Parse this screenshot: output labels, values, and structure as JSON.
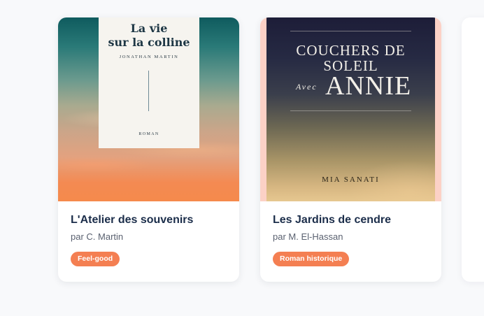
{
  "colors": {
    "background": "#f8f9fb",
    "card": "#ffffff",
    "title": "#1b2d4a",
    "author": "#5a6170",
    "tag": "#f47f52"
  },
  "books": [
    {
      "cover": {
        "title": "La vie\nsur la colline",
        "author": "JONATHAN MARTIN",
        "genre": "ROMAN"
      },
      "title": "L'Atelier des souvenirs",
      "author": "par C. Martin",
      "tag": "Feel-good"
    },
    {
      "cover": {
        "title": "COUCHERS DE\nSOLEIL",
        "avec": "Avec",
        "name": "ANNIE",
        "author": "MIA SANATI"
      },
      "title": "Les Jardins de cendre",
      "author": "par M. El-Hassan",
      "tag": "Roman historique"
    }
  ]
}
